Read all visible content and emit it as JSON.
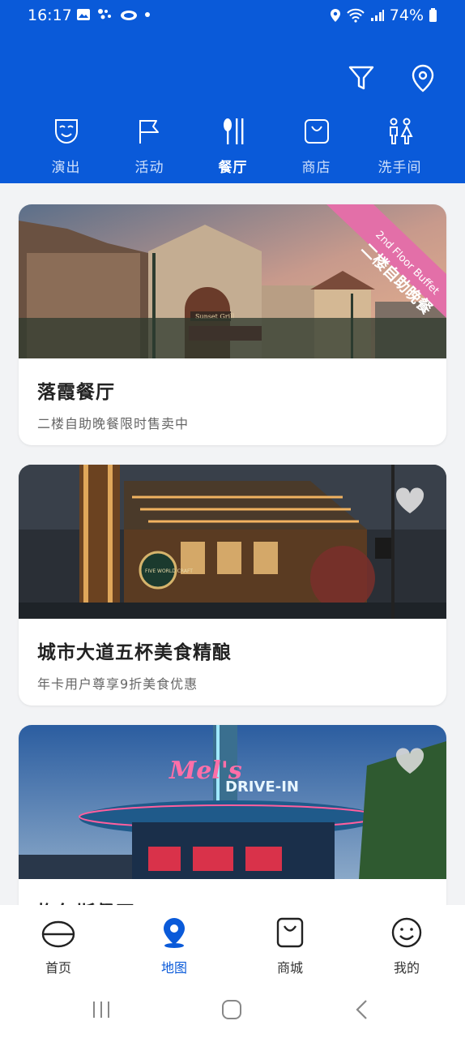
{
  "status": {
    "time": "16:17",
    "battery": "74%"
  },
  "tabs": [
    {
      "label": "演出",
      "icon": "theater-mask-icon"
    },
    {
      "label": "活动",
      "icon": "flag-icon"
    },
    {
      "label": "餐厅",
      "icon": "cutlery-icon",
      "active": true
    },
    {
      "label": "商店",
      "icon": "shopping-bag-icon"
    },
    {
      "label": "洗手间",
      "icon": "restroom-icon"
    }
  ],
  "cards": [
    {
      "title": "落霞餐厅",
      "subtitle": "二楼自助晚餐限时售卖中",
      "ribbon_en": "2nd Floor Buffet",
      "ribbon_cn": "二楼自助晚餐",
      "sign": "Sunset Grill"
    },
    {
      "title": "城市大道五杯美食精酿",
      "subtitle": "年卡用户尊享9折美食优惠",
      "sign": "FIVE WORLD CRAFT"
    },
    {
      "title": "梅尔斯餐厅",
      "subtitle": "",
      "sign1": "Mel's",
      "sign2": "DRIVE-IN"
    }
  ],
  "bottom_nav": [
    {
      "label": "首页",
      "icon": "home-cap-icon"
    },
    {
      "label": "地图",
      "icon": "map-pin-icon",
      "active": true
    },
    {
      "label": "商城",
      "icon": "shopping-bag-icon"
    },
    {
      "label": "我的",
      "icon": "smiley-icon"
    }
  ],
  "colors": {
    "brand": "#0a5ad9",
    "ribbon": "#e36fa8"
  }
}
